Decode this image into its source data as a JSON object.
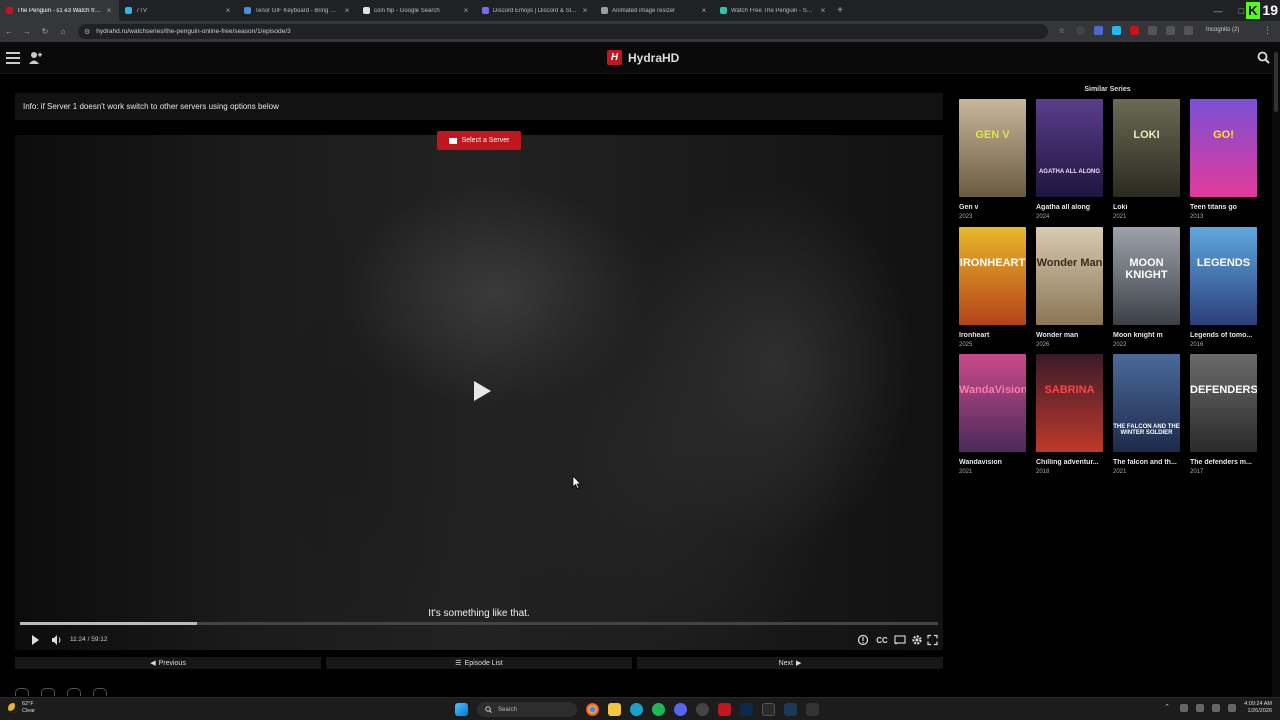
{
  "browser": {
    "tabs": [
      {
        "label": "The Penguin - s1 e3 Watch free",
        "color": "#c0161d",
        "active": true
      },
      {
        "label": "7TV",
        "color": "#29b6f6",
        "active": false
      },
      {
        "label": "Tenor GIF Keyboard - Bring Personality",
        "color": "#4a90d9",
        "active": false
      },
      {
        "label": "coin flip - Google Search",
        "color": "#e0e0e0",
        "active": false
      },
      {
        "label": "Discord Emojis | Discord & Slack",
        "color": "#7a6cf0",
        "active": false
      },
      {
        "label": "Animated image resizer",
        "color": "#9e9e9e",
        "active": false
      },
      {
        "label": "Watch Free The Penguin - Season",
        "color": "#2ec4a6",
        "active": false
      }
    ],
    "new_tab_symbol": "+",
    "url": "hydrahd.ru/watchseries/the-penguin-online-free/season/1/episode/3",
    "incognito_label": "Incognito (2)",
    "viewer_count": "19"
  },
  "site": {
    "brand_logo": "H",
    "brand_name": "HydraHD",
    "info_text": "Info: if Server 1 doesn't work switch to other servers using options below"
  },
  "player": {
    "server_button": "Select a Server",
    "subtitle": "It's something like that.",
    "time": "11:24 / 59:12",
    "progress": 0.193,
    "cc_label": "CC"
  },
  "nav": {
    "previous": "Previous",
    "episode_list": "Episode List",
    "next": "Next"
  },
  "similar": {
    "title": "Similar Series",
    "items": [
      {
        "title": "Gen v",
        "year": "2023",
        "colors": [
          "#c9b79a",
          "#6a5a40"
        ],
        "poster_text": "GEN V",
        "text_color": "#d7e84a"
      },
      {
        "title": "Agatha all along",
        "year": "2024",
        "colors": [
          "#5a3e8a",
          "#1e1540"
        ],
        "poster_text": "AGATHA ALL ALONG",
        "text_color": "#e8e0ff"
      },
      {
        "title": "Loki",
        "year": "2021",
        "colors": [
          "#6b6a55",
          "#2a2a1f"
        ],
        "poster_text": "LOKI",
        "text_color": "#f0e8c0"
      },
      {
        "title": "Teen titans go",
        "year": "2013",
        "colors": [
          "#7a4fd6",
          "#e23b9a"
        ],
        "poster_text": "GO!",
        "text_color": "#ffe033"
      },
      {
        "title": "Ironheart",
        "year": "2025",
        "colors": [
          "#e7b92a",
          "#b5421a"
        ],
        "poster_text": "IRONHEART",
        "text_color": "#ffffff"
      },
      {
        "title": "Wonder man",
        "year": "2026",
        "colors": [
          "#d8cbb0",
          "#8a7656"
        ],
        "poster_text": "Wonder Man",
        "text_color": "#3a2a1a"
      },
      {
        "title": "Moon knight m",
        "year": "2022",
        "colors": [
          "#9ea3ab",
          "#3c3f46"
        ],
        "poster_text": "MOON KNIGHT",
        "text_color": "#ffffff"
      },
      {
        "title": "Legends of tomo...",
        "year": "2016",
        "colors": [
          "#5fa8e0",
          "#2b3f7a"
        ],
        "poster_text": "LEGENDS",
        "text_color": "#ffffff"
      },
      {
        "title": "Wandavision",
        "year": "2021",
        "colors": [
          "#c94a8a",
          "#4b2a5a"
        ],
        "poster_text": "WandaVision",
        "text_color": "#ff7ab0"
      },
      {
        "title": "Chilling adventur...",
        "year": "2018",
        "colors": [
          "#3a1a2a",
          "#c0392b"
        ],
        "poster_text": "SABRINA",
        "text_color": "#ff4444"
      },
      {
        "title": "The falcon and th...",
        "year": "2021",
        "colors": [
          "#4a6a9a",
          "#1e2a4a"
        ],
        "poster_text": "THE FALCON AND THE WINTER SOLDIER",
        "text_color": "#ffffff"
      },
      {
        "title": "The defenders m...",
        "year": "2017",
        "colors": [
          "#6b6b6b",
          "#2a2a2a"
        ],
        "poster_text": "DEFENDERS",
        "text_color": "#ffffff"
      }
    ]
  },
  "taskbar": {
    "temperature": "62°F",
    "condition": "Clear",
    "search_placeholder": "Search",
    "time": "4:09:24 AM",
    "date": "1/26/2026"
  }
}
